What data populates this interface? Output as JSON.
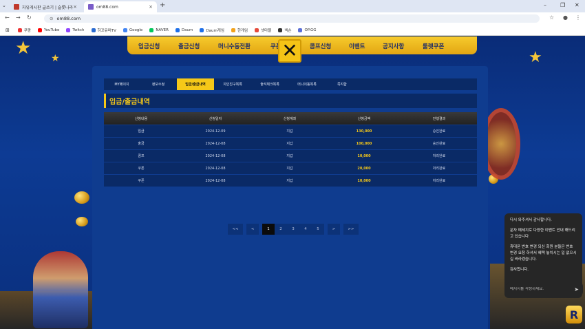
{
  "browser": {
    "tabs": [
      {
        "title": "자유게시판 글쓰기 | 슬롯나라",
        "active": false
      },
      {
        "title": "om88.com",
        "active": true
      }
    ],
    "url": "om88.com",
    "bookmarks": [
      "쿠팡",
      "YouTube",
      "Twitch",
      "하꼬유머TV",
      "Google",
      "NAVER",
      "Daum",
      "Daum게임",
      "한게임",
      "넷마블",
      "넥슨",
      "OP.GG"
    ]
  },
  "topnav": {
    "items": [
      "입금신청",
      "출금신청",
      "머니수동전환",
      "쿠폰",
      "콤프신청",
      "이벤트",
      "공지사항",
      "룰렛쿠폰"
    ]
  },
  "subtabs": [
    {
      "label": "MY페이지",
      "active": false
    },
    {
      "label": "정보수정",
      "active": false
    },
    {
      "label": "입금/출금내역",
      "active": true
    },
    {
      "label": "지인친구목록",
      "active": false
    },
    {
      "label": "출석체크목록",
      "active": false
    },
    {
      "label": "머니이동목록",
      "active": false
    },
    {
      "label": "쪽지함",
      "active": false
    }
  ],
  "heading": "입금/출금내역",
  "table": {
    "headers": [
      "신청내용",
      "신청일자",
      "신청계좌",
      "신청금액",
      "진행결과"
    ],
    "rows": [
      {
        "type": "입금",
        "date": "2024-12-09",
        "account": "지갑",
        "amount": "130,000",
        "status": "승인완료"
      },
      {
        "type": "출금",
        "date": "2024-12-08",
        "account": "지갑",
        "amount": "100,000",
        "status": "승인완료"
      },
      {
        "type": "콤프",
        "date": "2024-12-08",
        "account": "지갑",
        "amount": "10,000",
        "status": "처리완료"
      },
      {
        "type": "쿠폰",
        "date": "2024-12-08",
        "account": "지갑",
        "amount": "20,000",
        "status": "처리완료"
      },
      {
        "type": "쿠폰",
        "date": "2024-12-08",
        "account": "지갑",
        "amount": "10,000",
        "status": "처리완료"
      }
    ]
  },
  "pagination": {
    "first": "<<",
    "prev": "<",
    "pages": [
      "1",
      "2",
      "3",
      "4",
      "5"
    ],
    "current": "1",
    "next": ">",
    "last": ">>"
  },
  "chat": {
    "messages": [
      "다시 와주셔서 감사합니다.",
      "문자 메세지로 다양한 이벤트 안내 해드리고 있습니다",
      "휴대폰 번호 변경 되신 회원 분들은 번호 변경 요청 하셔서 혜택 놓치시는 일 없으시길 바라겠습니다.",
      "감사합니다."
    ],
    "input_placeholder": "메시지를 작성하세요.",
    "logo_letter": "R"
  }
}
